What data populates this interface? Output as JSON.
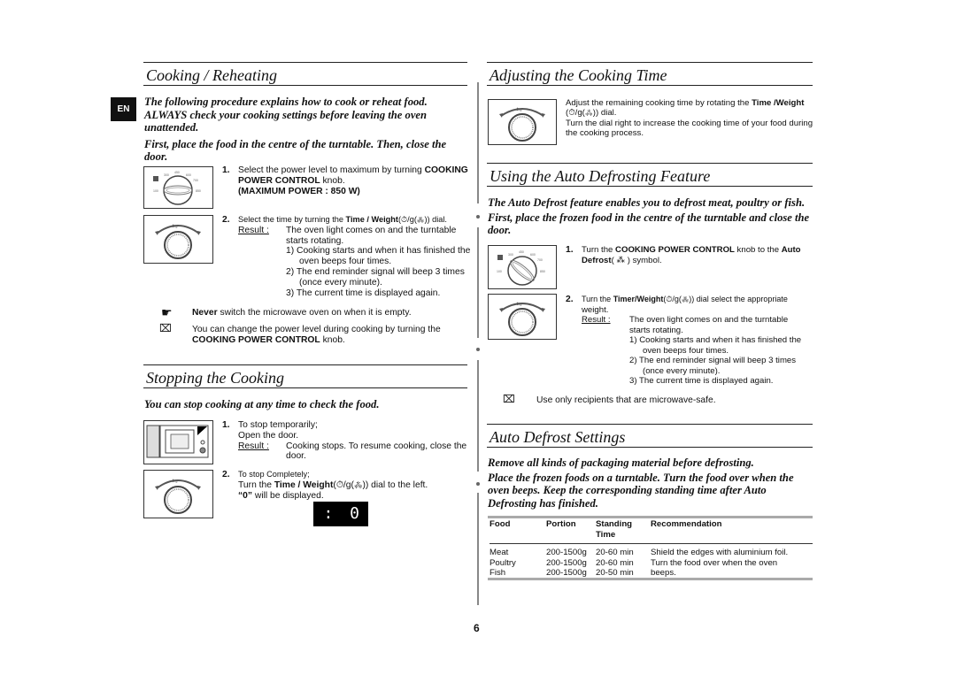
{
  "page": {
    "language_tab": "EN",
    "page_number": "6"
  },
  "cooking_reheating": {
    "title": "Cooking / Reheating",
    "intro_1": "The following procedure explains how to cook or reheat food.",
    "intro_2": "ALWAYS check your cooking settings before leaving the oven",
    "intro_3": "unattended.",
    "intro_4": "First, place the food in the centre of the turntable. Then, close the",
    "intro_5": "door.",
    "step1": {
      "number": "1.",
      "text_a": "Select the power level to maximum by turning ",
      "text_b": "COOKING",
      "text_c": "POWER CONTROL",
      "text_d": " knob.",
      "text_e": "(MAXIMUM POWER : 850 W)"
    },
    "step2": {
      "number": "2.",
      "text_a": "Select the time by turning the ",
      "text_b": "Time / Weight",
      "text_c": "(⏱/g(⁂)) dial.",
      "result_label": "Result :",
      "result_1": "The oven light comes on and the turntable",
      "result_2": "starts rotating.",
      "sub1_a": "1)  Cooking starts and when it has finished the",
      "sub1_b": "oven beeps four times.",
      "sub2_a": "2)  The end reminder signal will beep 3 times",
      "sub2_b": "(once every minute).",
      "sub3": "3)  The current time is displayed again."
    },
    "warning": {
      "bold": "Never",
      "text": " switch the microwave oven on when it is empty."
    },
    "note": {
      "text_a": "You can change the power level during cooking by turning the",
      "text_b": "COOKING POWER CONTROL",
      "text_c": " knob."
    }
  },
  "stopping": {
    "title": "Stopping the Cooking",
    "lead": "You can stop cooking at any time to check the food.",
    "step1": {
      "number": "1.",
      "line1": "To stop temporarily;",
      "line2": "Open the door.",
      "result_label": "Result :",
      "result_1": "Cooking stops. To resume cooking, close the",
      "result_2": "door."
    },
    "step2": {
      "number": "2.",
      "line1": "To stop Completely;",
      "line2_a": "Turn the ",
      "line2_b": "Time / Weight",
      "line2_c": "(⏱/g(⁂)) dial to the left.",
      "line3_a": "“0”",
      "line3_b": " will be displayed."
    },
    "display_value": ":  0"
  },
  "adjusting": {
    "title": "Adjusting the Cooking Time",
    "text_a": "Adjust the remaining cooking time by rotating the ",
    "text_b": "Time /Weight",
    "text_c": "(⏱/g(⁂)) dial.",
    "text_d": "Turn the dial right to increase the cooking time of your food during",
    "text_e": "the cooking process."
  },
  "auto_defrost": {
    "title": "Using the Auto Defrosting Feature",
    "lead_1": "The Auto Defrost feature enables you to defrost meat, poultry or fish.",
    "lead_2": "First, place the frozen food in the centre of the turntable and close the",
    "lead_3": "door.",
    "step1": {
      "number": "1.",
      "text_a": "Turn the ",
      "text_b": "COOKING POWER CONTROL",
      "text_c": " knob to the ",
      "text_d": "Auto",
      "text_e": "Defrost",
      "text_f": "( ⁂ ) symbol."
    },
    "step2": {
      "number": "2.",
      "text_a": "Turn the ",
      "text_b": "Timer/Weight",
      "text_c": "(⏱/g(⁂)) dial select the appropriate",
      "text_d": "weight.",
      "result_label": "Result :",
      "result_1": "The oven light comes on and the turntable",
      "result_2": "starts rotating.",
      "sub1_a": "1) Cooking starts and when it has finished the",
      "sub1_b": "oven beeps four times.",
      "sub2_a": "2) The end reminder signal will beep 3 times",
      "sub2_b": "(once every minute).",
      "sub3": "3) The current time is displayed again."
    },
    "note": "Use only recipients that are microwave-safe."
  },
  "defrost_settings": {
    "title": "Auto Defrost Settings",
    "lead_1": "Remove all kinds of packaging material before defrosting.",
    "lead_2": "Place the frozen foods on a turntable. Turn the food over when the",
    "lead_3": "oven beeps. Keep the corresponding standing time after Auto",
    "lead_4": "Defrosting has finished.",
    "table": {
      "headers": [
        "Food",
        "Portion",
        "Standing",
        "Recommendation"
      ],
      "header_line2": "Time",
      "rows": [
        [
          "Meat",
          "200-1500g",
          "20-60 min",
          "Shield the edges with aluminium foil."
        ],
        [
          "Poultry",
          "200-1500g",
          "20-60 min",
          "Turn the food over when the oven"
        ],
        [
          "Fish",
          "200-1500g",
          "20-50 min",
          "beeps."
        ]
      ]
    }
  },
  "icons": {
    "warning": "☛",
    "note": "⌧"
  }
}
